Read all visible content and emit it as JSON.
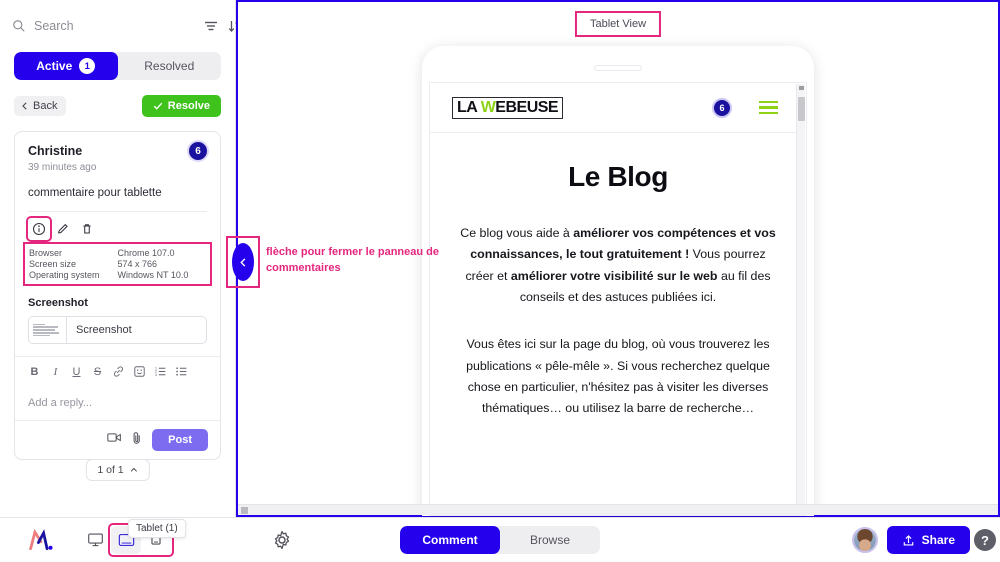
{
  "sidebar": {
    "search": {
      "placeholder": "Search",
      "value": ""
    },
    "filter_icon": "filter-icon",
    "sort_icon": "sort-icon",
    "tabs": [
      {
        "label": "Active",
        "badge": "1",
        "active": true
      },
      {
        "label": "Resolved",
        "badge": "",
        "active": false
      }
    ],
    "back_label": "Back",
    "resolve_label": "Resolve",
    "comment": {
      "author": "Christine",
      "time": "39 minutes ago",
      "text": "commentaire pour tablette",
      "pin_number": "6",
      "actions": [
        {
          "name": "info-icon",
          "glyph": "i"
        },
        {
          "name": "edit-icon",
          "glyph": "pencil"
        },
        {
          "name": "delete-icon",
          "glyph": "trash"
        }
      ],
      "meta": [
        {
          "key": "Browser",
          "value": "Chrome 107.0"
        },
        {
          "key": "Screen size",
          "value": "574 x 766"
        },
        {
          "key": "Operating system",
          "value": "Windows NT 10.0"
        }
      ]
    },
    "screenshot": {
      "title": "Screenshot",
      "item_label": "Screenshot"
    },
    "format_tools": [
      "B",
      "I",
      "U",
      "S",
      "link-icon",
      "emoji-icon",
      "ordered-list-icon",
      "bullet-list-icon"
    ],
    "reply_placeholder": "Add a reply...",
    "reply_value": "",
    "video_icon": "video-icon",
    "attach_icon": "paperclip-icon",
    "post_label": "Post",
    "pager_label": "1 of 1"
  },
  "canvas": {
    "view_label": "Tablet View",
    "annotation": "flèche pour fermer le panneau de commentaires",
    "collapse_icon": "chevron-left-icon",
    "site": {
      "brand_part1": "LA ",
      "brand_w": "W",
      "brand_part2": "EBEUSE",
      "pin_number": "6",
      "menu_icon": "hamburger-menu-icon",
      "heading": "Le Blog",
      "paragraph1_a": "Ce blog vous aide à ",
      "paragraph1_b": "améliorer vos compétences et vos connaissances, le tout gratuitement !",
      "paragraph1_c": " Vous pourrez créer et ",
      "paragraph1_d": "améliorer votre visibilité sur le web",
      "paragraph1_e": " au fil des conseils et des astuces publiées ici.",
      "paragraph2": "Vous êtes ici sur la page du blog, où vous trouverez les publications « pêle-mêle ». Si vous recherchez quelque chose en particulier, n'hésitez pas à visiter les diverses thématiques… ou utilisez la barre de recherche…"
    }
  },
  "bottombar": {
    "logo_name": "marker-io-logo",
    "devices": [
      {
        "name": "desktop-icon",
        "selected": false
      },
      {
        "name": "tablet-icon",
        "selected": true
      },
      {
        "name": "mobile-icon",
        "selected": false
      }
    ],
    "device_tooltip": "Tablet (1)",
    "settings_icon": "gear-icon",
    "modes": [
      {
        "label": "Comment",
        "active": true
      },
      {
        "label": "Browse",
        "active": false
      }
    ],
    "avatar_name": "user-avatar",
    "share_label": "Share",
    "help_label": "?"
  },
  "colors": {
    "accent_blue": "#2400ec",
    "pin_blue": "#1a129e",
    "resolve_green": "#3fc21c",
    "post_purple": "#7d6cf0",
    "annotation_pink": "#e5267f",
    "brand_green": "#8ed216"
  }
}
